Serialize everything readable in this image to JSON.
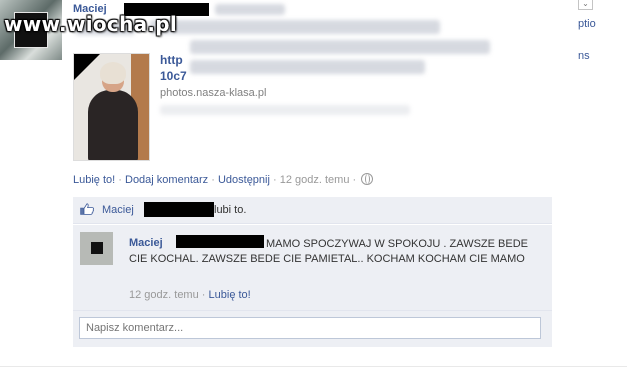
{
  "watermark": "www.wiocha.pl",
  "post": {
    "author": "Maciej",
    "link_title": "http 10c7",
    "link_domain": "photos.nasza-klasa.pl",
    "right_text_top": "ptio",
    "right_text_bottom": "ns"
  },
  "actions": {
    "like": "Lubię to!",
    "comment": "Dodaj komentarz",
    "share": "Udostępnij",
    "separator": "·",
    "time": "12 godz. temu"
  },
  "likes": {
    "name": "Maciej",
    "suffix": "lubi to."
  },
  "comment": {
    "author": "Maciej",
    "text": "MAMO SPOCZYWAJ W SPOKOJU . ZAWSZE BEDE CIE KOCHAL. ZAWSZE BEDE CIE PAMIETAL.. KOCHAM KOCHAM CIE MAMO",
    "time": "12 godz. temu",
    "separator": "·",
    "like": "Lubię to!"
  },
  "reply": {
    "placeholder": "Napisz komentarz..."
  },
  "colors": {
    "link_blue": "#3b5998",
    "comment_bg": "#edeff4"
  }
}
